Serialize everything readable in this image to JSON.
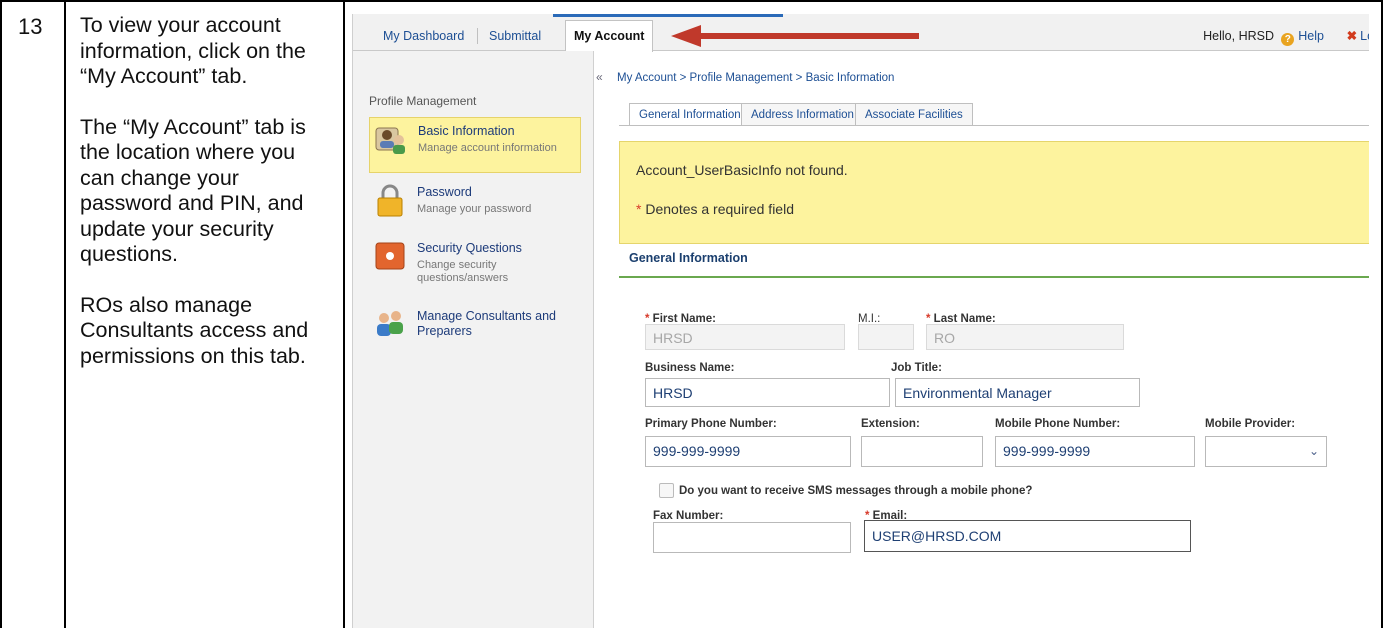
{
  "step": {
    "number": "13",
    "paragraphs": [
      "To view your account information, click on the “My Account” tab.",
      "The “My Account” tab is the location where you can change your password and PIN, and update your security questions.",
      "ROs also manage Consultants access and permissions on this tab."
    ]
  },
  "topnav": {
    "tabs": [
      "My Dashboard",
      "Submittal",
      "My Account"
    ],
    "greeting": "Hello, HRSD",
    "help": "Help",
    "logout": "Log"
  },
  "sidebar": {
    "title": "Profile Management",
    "items": [
      {
        "label": "Basic Information",
        "sub": "Manage account information",
        "icon": "user-card-icon"
      },
      {
        "label": "Password",
        "sub": "Manage your password",
        "icon": "padlock-icon"
      },
      {
        "label": "Security Questions",
        "sub": "Change security questions/answers",
        "icon": "safe-icon"
      },
      {
        "label": "Manage Consultants and Preparers",
        "sub": "",
        "icon": "users-icon"
      }
    ]
  },
  "main": {
    "breadcrumb": "My Account > Profile Management > Basic Information",
    "tabs": [
      "General Information",
      "Address Information",
      "Associate Facilities"
    ],
    "notice": "Account_UserBasicInfo not found.",
    "required_note": "Denotes a required field",
    "section_title": "General Information"
  },
  "form": {
    "first_name_label": "First Name:",
    "first_name_value": "HRSD",
    "mi_label": "M.I.:",
    "mi_value": "",
    "last_name_label": "Last Name:",
    "last_name_value": "RO",
    "business_label": "Business Name:",
    "business_value": "HRSD",
    "job_title_label": "Job Title:",
    "job_title_value": "Environmental Manager",
    "primary_phone_label": "Primary Phone Number:",
    "primary_phone_value": "999-999-9999",
    "extension_label": "Extension:",
    "extension_value": "",
    "mobile_label": "Mobile Phone Number:",
    "mobile_value": "999-999-9999",
    "provider_label": "Mobile Provider:",
    "provider_value": "",
    "sms_label": "Do you want to receive SMS messages through a mobile phone?",
    "fax_label": "Fax Number:",
    "fax_value": "",
    "email_label": "Email:",
    "email_value": "USER@HRSD.COM"
  },
  "colors": {
    "arrow": "#c0392b",
    "notice_bg": "#fdf39e",
    "link": "#1d4f94",
    "section_line": "#6aa84f"
  }
}
